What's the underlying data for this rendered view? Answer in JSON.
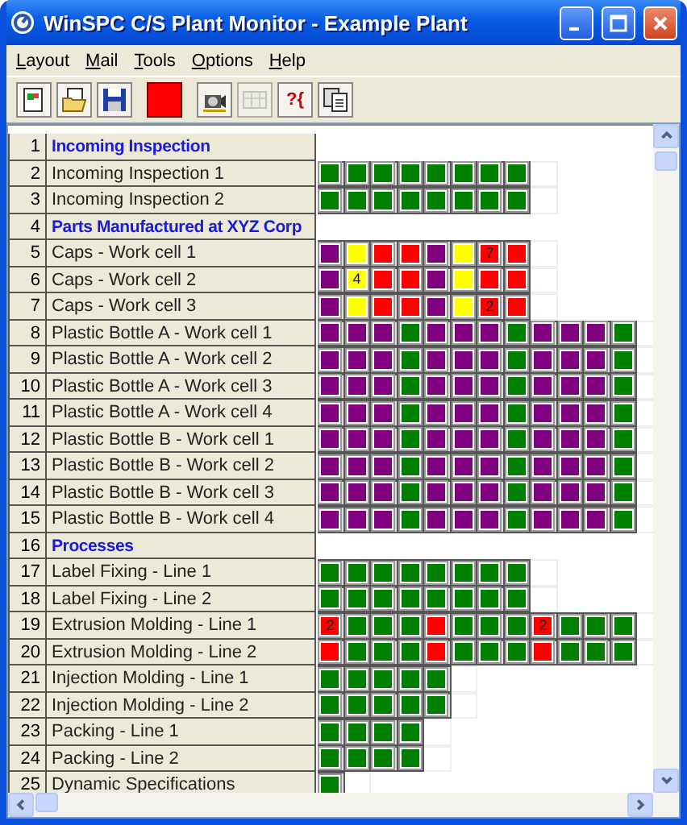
{
  "window": {
    "title": "WinSPC C/S Plant Monitor - Example Plant"
  },
  "menu": [
    "Layout",
    "Mail",
    "Tools",
    "Options",
    "Help"
  ],
  "toolbar": [
    {
      "kind": "new"
    },
    {
      "kind": "open"
    },
    {
      "kind": "save"
    },
    {
      "kind": "stop"
    },
    {
      "kind": "camera"
    },
    {
      "kind": "grid",
      "disabled": true
    },
    {
      "kind": "text",
      "label": "?{"
    },
    {
      "kind": "copy"
    }
  ],
  "rows": [
    {
      "number": "1",
      "name": "Incoming Inspection",
      "kind": "header",
      "cells": []
    },
    {
      "number": "2",
      "name": "Incoming Inspection 1",
      "kind": "item",
      "cells": [
        {
          "color": "#008000"
        },
        {
          "color": "#008000"
        },
        {
          "color": "#008000"
        },
        {
          "color": "#008000"
        },
        {
          "color": "#008000"
        },
        {
          "color": "#008000"
        },
        {
          "color": "#008000"
        },
        {
          "color": "#008000"
        }
      ]
    },
    {
      "number": "3",
      "name": "Incoming Inspection 2",
      "kind": "item",
      "cells": [
        {
          "color": "#008000"
        },
        {
          "color": "#008000"
        },
        {
          "color": "#008000"
        },
        {
          "color": "#008000"
        },
        {
          "color": "#008000"
        },
        {
          "color": "#008000"
        },
        {
          "color": "#008000"
        },
        {
          "color": "#008000"
        }
      ]
    },
    {
      "number": "4",
      "name": "Parts Manufactured at XYZ Corp",
      "kind": "header",
      "cells": []
    },
    {
      "number": "5",
      "name": "Caps - Work cell 1",
      "kind": "item",
      "cells": [
        {
          "color": "#800080"
        },
        {
          "color": "#ffff00"
        },
        {
          "color": "#ff0000"
        },
        {
          "color": "#ff0000"
        },
        {
          "color": "#800080"
        },
        {
          "color": "#ffff00"
        },
        {
          "color": "#ff0000",
          "label": "7"
        },
        {
          "color": "#ff0000"
        }
      ]
    },
    {
      "number": "6",
      "name": "Caps - Work cell 2",
      "kind": "item",
      "cells": [
        {
          "color": "#800080"
        },
        {
          "color": "#ffff00",
          "label": "4"
        },
        {
          "color": "#ff0000"
        },
        {
          "color": "#ff0000"
        },
        {
          "color": "#800080"
        },
        {
          "color": "#ffff00"
        },
        {
          "color": "#ff0000"
        },
        {
          "color": "#ff0000"
        }
      ]
    },
    {
      "number": "7",
      "name": "Caps - Work cell 3",
      "kind": "item",
      "cells": [
        {
          "color": "#800080"
        },
        {
          "color": "#ffff00"
        },
        {
          "color": "#ff0000"
        },
        {
          "color": "#ff0000"
        },
        {
          "color": "#800080"
        },
        {
          "color": "#ffff00"
        },
        {
          "color": "#ff0000",
          "label": "2"
        },
        {
          "color": "#ff0000"
        }
      ]
    },
    {
      "number": "8",
      "name": "Plastic Bottle A - Work cell 1",
      "kind": "item",
      "cells": [
        {
          "color": "#800080"
        },
        {
          "color": "#800080"
        },
        {
          "color": "#800080"
        },
        {
          "color": "#008000"
        },
        {
          "color": "#800080"
        },
        {
          "color": "#800080"
        },
        {
          "color": "#800080"
        },
        {
          "color": "#008000"
        },
        {
          "color": "#800080"
        },
        {
          "color": "#800080"
        },
        {
          "color": "#800080"
        },
        {
          "color": "#008000"
        }
      ]
    },
    {
      "number": "9",
      "name": "Plastic Bottle A - Work cell 2",
      "kind": "item",
      "cells": [
        {
          "color": "#800080"
        },
        {
          "color": "#800080"
        },
        {
          "color": "#800080"
        },
        {
          "color": "#008000"
        },
        {
          "color": "#800080"
        },
        {
          "color": "#800080"
        },
        {
          "color": "#800080"
        },
        {
          "color": "#008000"
        },
        {
          "color": "#800080"
        },
        {
          "color": "#800080"
        },
        {
          "color": "#800080"
        },
        {
          "color": "#008000"
        }
      ]
    },
    {
      "number": "10",
      "name": "Plastic Bottle A - Work cell 3",
      "kind": "item",
      "cells": [
        {
          "color": "#800080"
        },
        {
          "color": "#800080"
        },
        {
          "color": "#800080"
        },
        {
          "color": "#008000"
        },
        {
          "color": "#800080"
        },
        {
          "color": "#800080"
        },
        {
          "color": "#800080"
        },
        {
          "color": "#008000"
        },
        {
          "color": "#800080"
        },
        {
          "color": "#800080"
        },
        {
          "color": "#800080"
        },
        {
          "color": "#008000"
        }
      ]
    },
    {
      "number": "11",
      "name": "Plastic Bottle A - Work cell 4",
      "kind": "item",
      "cells": [
        {
          "color": "#800080"
        },
        {
          "color": "#800080"
        },
        {
          "color": "#800080"
        },
        {
          "color": "#008000"
        },
        {
          "color": "#800080"
        },
        {
          "color": "#800080"
        },
        {
          "color": "#800080"
        },
        {
          "color": "#008000"
        },
        {
          "color": "#800080"
        },
        {
          "color": "#800080"
        },
        {
          "color": "#800080"
        },
        {
          "color": "#008000"
        }
      ]
    },
    {
      "number": "12",
      "name": "Plastic Bottle B - Work cell 1",
      "kind": "item",
      "cells": [
        {
          "color": "#800080"
        },
        {
          "color": "#800080"
        },
        {
          "color": "#800080"
        },
        {
          "color": "#008000"
        },
        {
          "color": "#800080"
        },
        {
          "color": "#800080"
        },
        {
          "color": "#800080"
        },
        {
          "color": "#008000"
        },
        {
          "color": "#800080"
        },
        {
          "color": "#800080"
        },
        {
          "color": "#800080"
        },
        {
          "color": "#008000"
        }
      ]
    },
    {
      "number": "13",
      "name": "Plastic Bottle B - Work cell 2",
      "kind": "item",
      "cells": [
        {
          "color": "#800080"
        },
        {
          "color": "#800080"
        },
        {
          "color": "#800080"
        },
        {
          "color": "#008000"
        },
        {
          "color": "#800080"
        },
        {
          "color": "#800080"
        },
        {
          "color": "#800080"
        },
        {
          "color": "#008000"
        },
        {
          "color": "#800080"
        },
        {
          "color": "#800080"
        },
        {
          "color": "#800080"
        },
        {
          "color": "#008000"
        }
      ]
    },
    {
      "number": "14",
      "name": "Plastic Bottle B - Work cell 3",
      "kind": "item",
      "cells": [
        {
          "color": "#800080"
        },
        {
          "color": "#800080"
        },
        {
          "color": "#800080"
        },
        {
          "color": "#008000"
        },
        {
          "color": "#800080"
        },
        {
          "color": "#800080"
        },
        {
          "color": "#800080"
        },
        {
          "color": "#008000"
        },
        {
          "color": "#800080"
        },
        {
          "color": "#800080"
        },
        {
          "color": "#800080"
        },
        {
          "color": "#008000"
        }
      ]
    },
    {
      "number": "15",
      "name": "Plastic Bottle B - Work cell 4",
      "kind": "item",
      "cells": [
        {
          "color": "#800080"
        },
        {
          "color": "#800080"
        },
        {
          "color": "#800080"
        },
        {
          "color": "#008000"
        },
        {
          "color": "#800080"
        },
        {
          "color": "#800080"
        },
        {
          "color": "#800080"
        },
        {
          "color": "#008000"
        },
        {
          "color": "#800080"
        },
        {
          "color": "#800080"
        },
        {
          "color": "#800080"
        },
        {
          "color": "#008000"
        }
      ]
    },
    {
      "number": "16",
      "name": "Processes",
      "kind": "header",
      "cells": []
    },
    {
      "number": "17",
      "name": "Label Fixing - Line 1",
      "kind": "item",
      "cells": [
        {
          "color": "#008000"
        },
        {
          "color": "#008000"
        },
        {
          "color": "#008000"
        },
        {
          "color": "#008000"
        },
        {
          "color": "#008000"
        },
        {
          "color": "#008000"
        },
        {
          "color": "#008000"
        },
        {
          "color": "#008000"
        }
      ]
    },
    {
      "number": "18",
      "name": "Label Fixing - Line 2",
      "kind": "item",
      "cells": [
        {
          "color": "#008000"
        },
        {
          "color": "#008000"
        },
        {
          "color": "#008000"
        },
        {
          "color": "#008000"
        },
        {
          "color": "#008000"
        },
        {
          "color": "#008000"
        },
        {
          "color": "#008000"
        },
        {
          "color": "#008000"
        }
      ]
    },
    {
      "number": "19",
      "name": "Extrusion Molding - Line 1",
      "kind": "item",
      "cells": [
        {
          "color": "#ff0000",
          "label": "2"
        },
        {
          "color": "#008000"
        },
        {
          "color": "#008000"
        },
        {
          "color": "#008000"
        },
        {
          "color": "#ff0000"
        },
        {
          "color": "#008000"
        },
        {
          "color": "#008000"
        },
        {
          "color": "#008000"
        },
        {
          "color": "#ff0000",
          "label": "2"
        },
        {
          "color": "#008000"
        },
        {
          "color": "#008000"
        },
        {
          "color": "#008000"
        }
      ]
    },
    {
      "number": "20",
      "name": "Extrusion Molding - Line 2",
      "kind": "item",
      "cells": [
        {
          "color": "#ff0000"
        },
        {
          "color": "#008000"
        },
        {
          "color": "#008000"
        },
        {
          "color": "#008000"
        },
        {
          "color": "#ff0000"
        },
        {
          "color": "#008000"
        },
        {
          "color": "#008000"
        },
        {
          "color": "#008000"
        },
        {
          "color": "#ff0000"
        },
        {
          "color": "#008000"
        },
        {
          "color": "#008000"
        },
        {
          "color": "#008000"
        }
      ]
    },
    {
      "number": "21",
      "name": "Injection Molding - Line 1",
      "kind": "item",
      "cells": [
        {
          "color": "#008000"
        },
        {
          "color": "#008000"
        },
        {
          "color": "#008000"
        },
        {
          "color": "#008000"
        },
        {
          "color": "#008000"
        }
      ]
    },
    {
      "number": "22",
      "name": "Injection Molding - Line 2",
      "kind": "item",
      "cells": [
        {
          "color": "#008000"
        },
        {
          "color": "#008000"
        },
        {
          "color": "#008000"
        },
        {
          "color": "#008000"
        },
        {
          "color": "#008000"
        }
      ]
    },
    {
      "number": "23",
      "name": "Packing - Line 1",
      "kind": "item",
      "cells": [
        {
          "color": "#008000"
        },
        {
          "color": "#008000"
        },
        {
          "color": "#008000"
        },
        {
          "color": "#008000"
        }
      ]
    },
    {
      "number": "24",
      "name": "Packing - Line 2",
      "kind": "item",
      "cells": [
        {
          "color": "#008000"
        },
        {
          "color": "#008000"
        },
        {
          "color": "#008000"
        },
        {
          "color": "#008000"
        }
      ]
    },
    {
      "number": "25",
      "name": "Dynamic Specifications",
      "kind": "item",
      "cells": [
        {
          "color": "#008000"
        }
      ]
    }
  ]
}
